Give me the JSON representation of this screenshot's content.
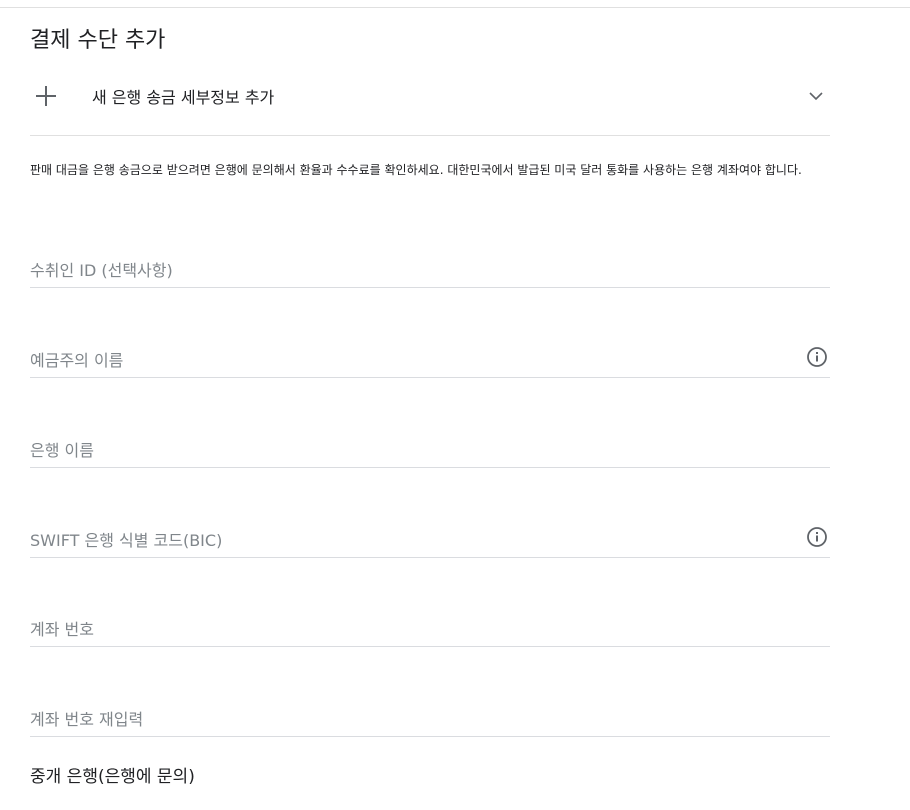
{
  "title": "결제 수단 추가",
  "expander": {
    "label": "새 은행 송금 세부정보 추가"
  },
  "description": "판매 대금을 은행 송금으로 받으려면 은행에 문의해서 환율과 수수료를 확인하세요. 대한민국에서 발급된 미국 달러 통화를 사용하는 은행 계좌여야 합니다.",
  "fields": [
    {
      "label": "수취인 ID (선택사항)",
      "icon": null
    },
    {
      "label": "예금주의 이름",
      "icon": "info-icon"
    },
    {
      "label": "은행 이름",
      "icon": null
    },
    {
      "label": "SWIFT 은행 식별 코드(BIC)",
      "icon": "info-icon"
    },
    {
      "label": "계좌 번호",
      "icon": null
    },
    {
      "label": "계좌 번호 재입력",
      "icon": null
    }
  ],
  "intermediary_section": {
    "title": "중개 은행(은행에 문의)"
  }
}
